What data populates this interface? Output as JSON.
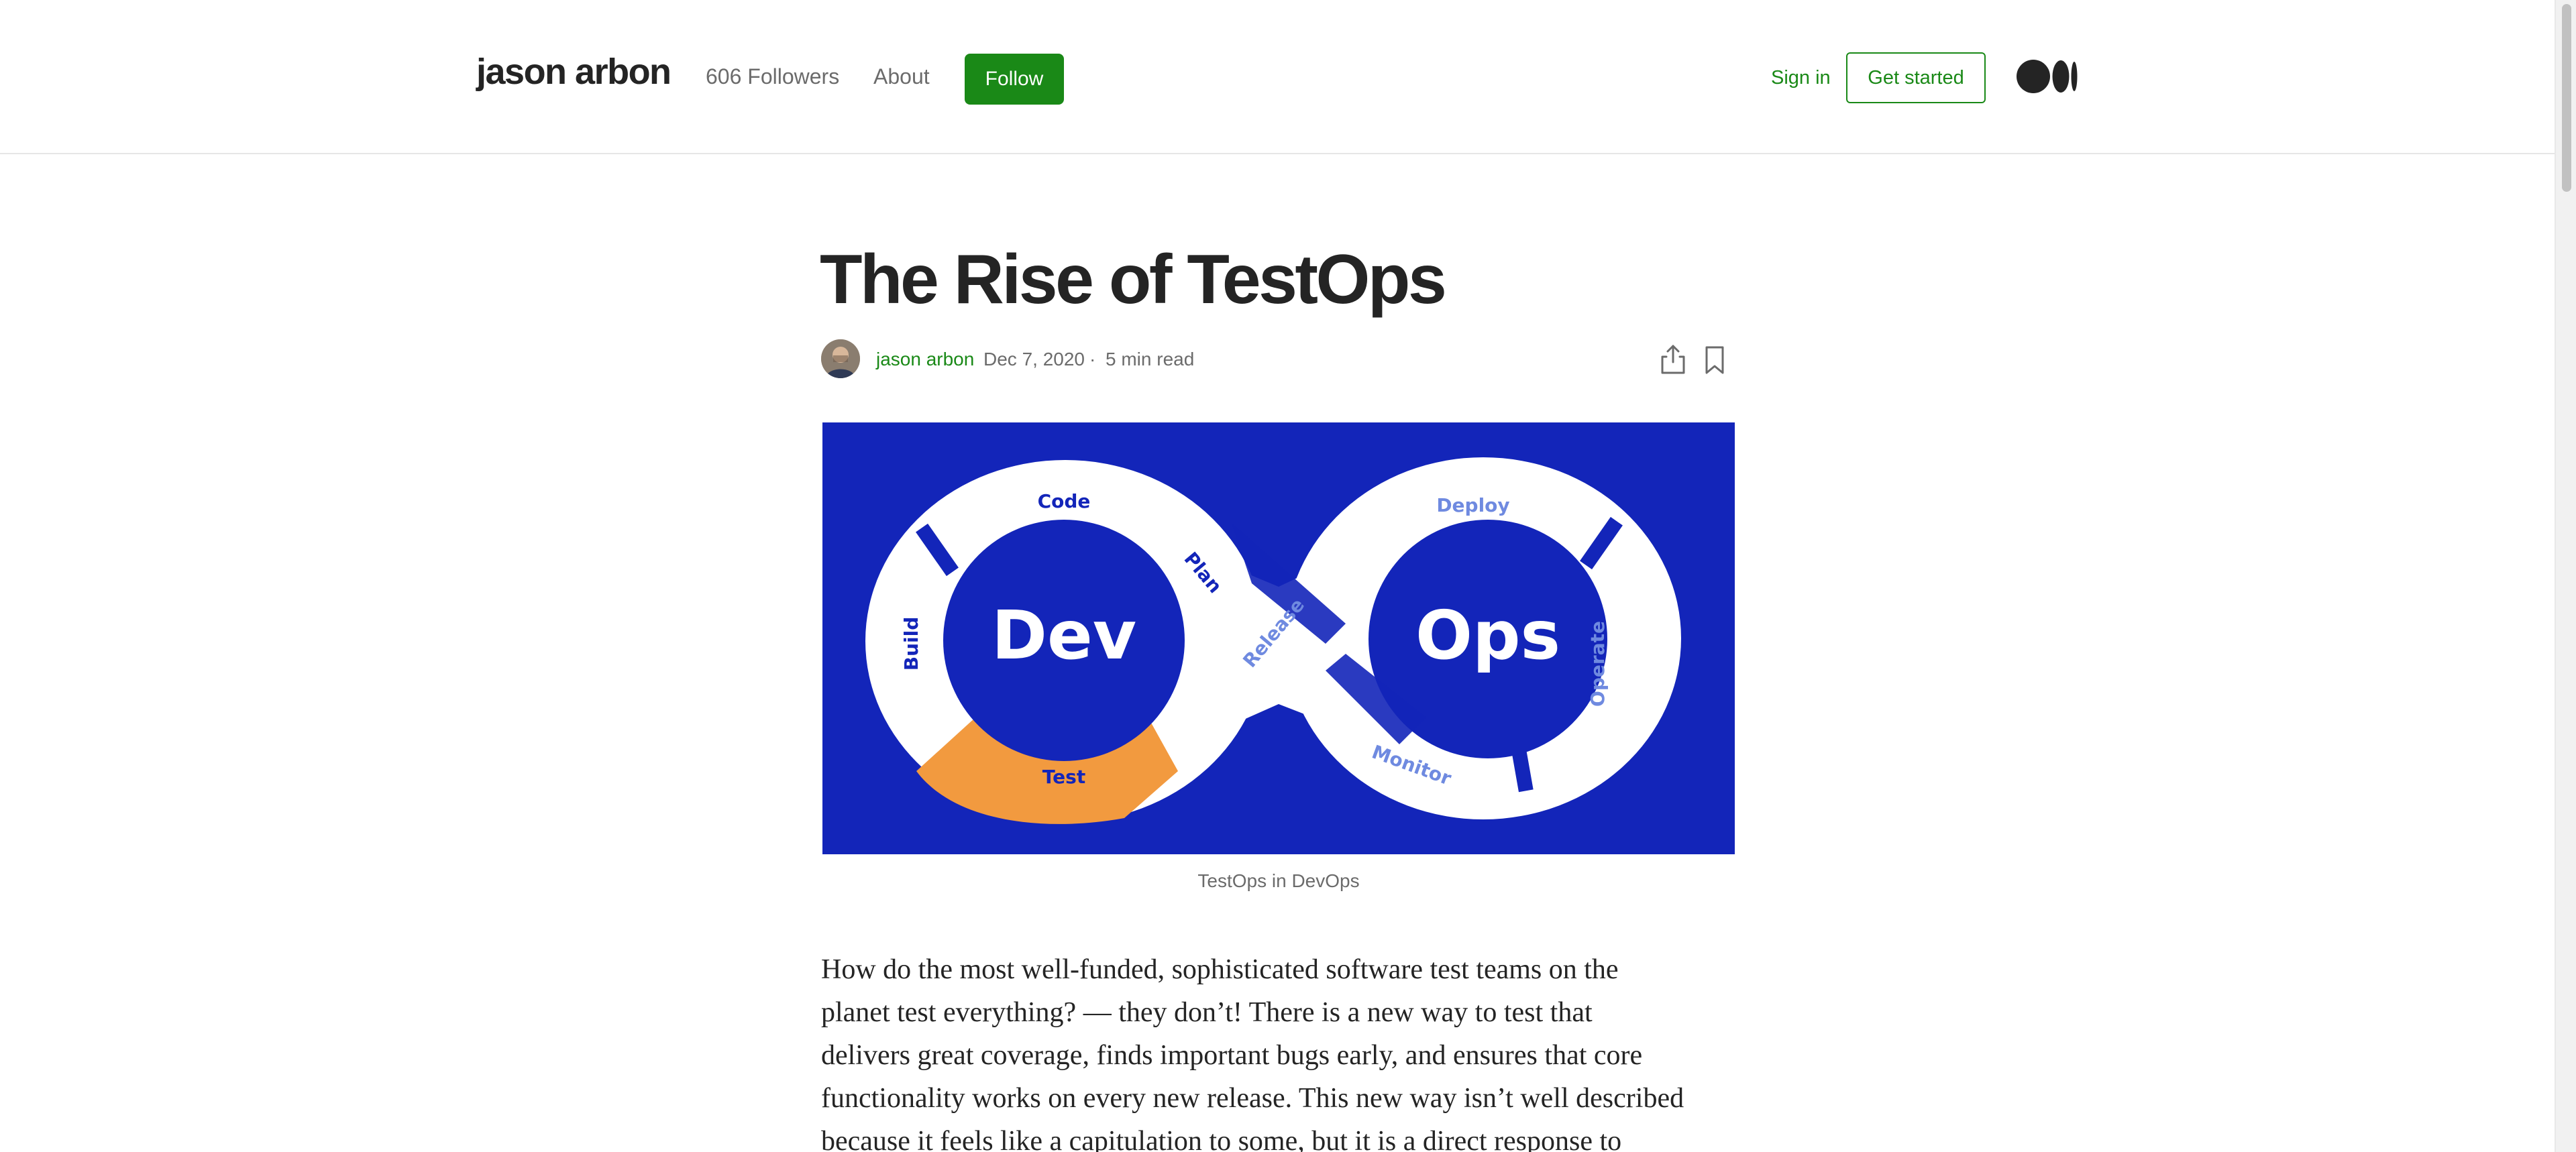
{
  "header": {
    "brand": "jason arbon",
    "followers": "606 Followers",
    "about": "About",
    "follow_label": "Follow",
    "sign_in": "Sign in",
    "get_started": "Get started"
  },
  "article": {
    "title": "The Rise of TestOps",
    "author": "jason arbon",
    "date": "Dec 7, 2020",
    "separator": "·",
    "read_time": "5 min read",
    "image": {
      "caption": "TestOps in DevOps",
      "labels": {
        "dev": "Dev",
        "ops": "Ops",
        "code": "Code",
        "build": "Build",
        "test": "Test",
        "plan": "Plan",
        "release": "Release",
        "deploy": "Deploy",
        "operate": "Operate",
        "monitor": "Monitor"
      }
    },
    "body_lines": [
      "How do the most well-funded, sophisticated software test teams on the",
      "planet test everything? — they don’t! There is a new way to test that",
      "delivers great coverage, finds important bugs early, and ensures that core",
      "functionality works on every new release. This new way isn’t well described",
      "because it feels like a capitulation to some, but it is a direct response to"
    ]
  },
  "colors": {
    "brand_green": "#1a8917",
    "hero_blue": "#1325b9",
    "test_orange": "#f29a3f",
    "label_light_blue": "#6f8ae0"
  },
  "icons": [
    "medium-logo",
    "share-icon",
    "bookmark-icon",
    "avatar"
  ]
}
